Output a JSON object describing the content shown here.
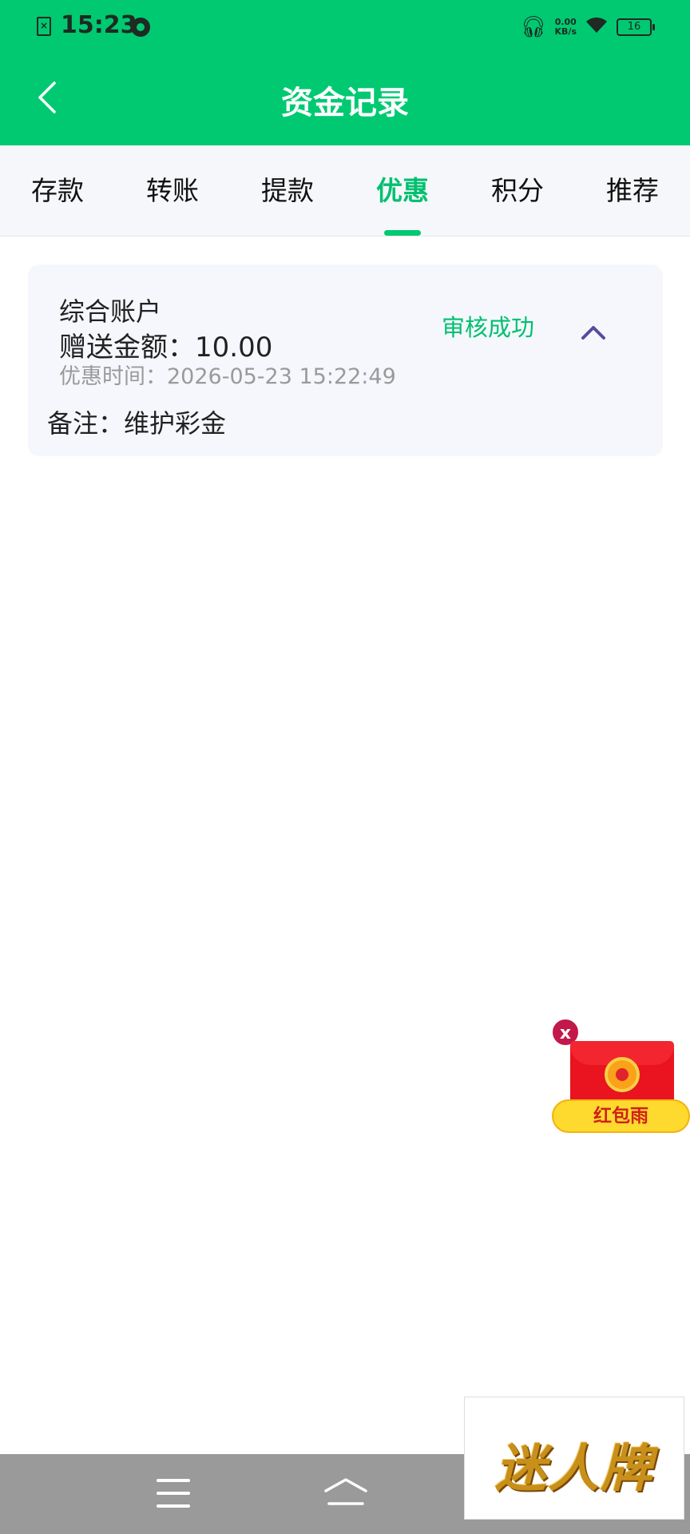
{
  "status_bar": {
    "time": "15:23",
    "net_speed_value": "0.00",
    "net_speed_unit": "KB/s",
    "battery": "16"
  },
  "header": {
    "title": "资金记录",
    "background": "#00C972"
  },
  "tabs": [
    {
      "label": "存款",
      "active": false
    },
    {
      "label": "转账",
      "active": false
    },
    {
      "label": "提款",
      "active": false
    },
    {
      "label": "优惠",
      "active": true
    },
    {
      "label": "积分",
      "active": false
    },
    {
      "label": "推荐",
      "active": false
    }
  ],
  "record": {
    "account": "综合账户",
    "amount_label": "赠送金额：",
    "amount_value": "10.00",
    "time_label": "优惠时间：",
    "time_value": "2026-05-23 15:22:49",
    "status": "审核成功",
    "remark_label": "备注：",
    "remark_value": "维护彩金"
  },
  "red_packet": {
    "close_glyph": "x",
    "label": "红包雨"
  },
  "ad": {
    "logo_text": "迷人牌"
  },
  "icons": {
    "back": "chevron-left-icon",
    "toggle": "chevron-up-icon",
    "menu": "menu-icon",
    "home": "home-icon"
  },
  "colors": {
    "accent": "#00C06F",
    "tab_bar_bg": "#F5F7FA",
    "card_bg": "#F5F7FC"
  }
}
